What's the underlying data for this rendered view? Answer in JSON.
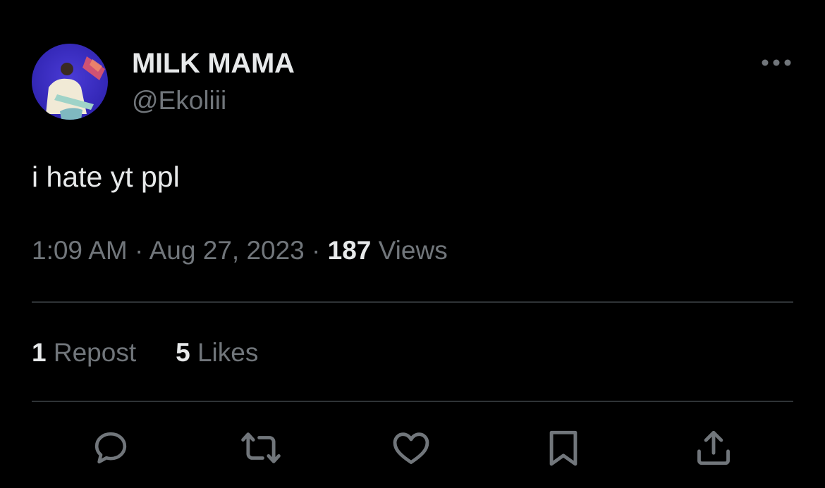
{
  "author": {
    "display_name": "MILK MAMA",
    "handle": "@Ekoliii"
  },
  "tweet": {
    "text": "i hate yt ppl"
  },
  "meta": {
    "time": "1:09 AM",
    "separator": "·",
    "date": "Aug 27, 2023",
    "views_count": "187",
    "views_label": "Views"
  },
  "stats": {
    "reposts_count": "1",
    "reposts_label": "Repost",
    "likes_count": "5",
    "likes_label": "Likes"
  },
  "icons": {
    "more": "more-horizontal-icon",
    "reply": "reply-icon",
    "repost": "repost-icon",
    "like": "heart-icon",
    "bookmark": "bookmark-icon",
    "share": "share-icon"
  },
  "colors": {
    "background": "#000000",
    "primary_text": "#e7e9ea",
    "secondary_text": "#71767b",
    "divider": "#2f3336"
  }
}
